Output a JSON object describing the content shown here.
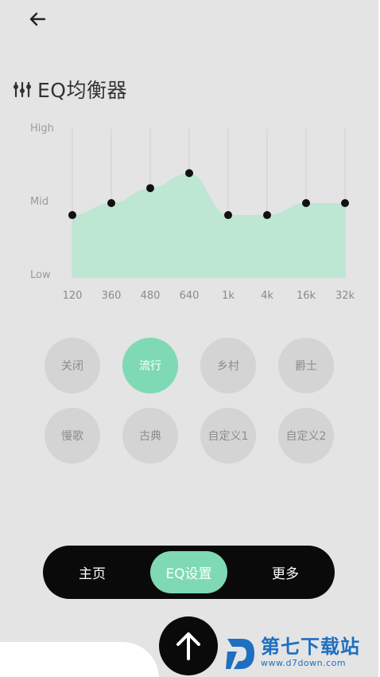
{
  "header": {
    "back_icon": "arrow-left-icon",
    "title_icon": "equalizer-sliders-icon",
    "title": "EQ均衡器"
  },
  "chart_data": {
    "type": "area",
    "categories": [
      "120",
      "360",
      "480",
      "640",
      "1k",
      "4k",
      "16k",
      "32k"
    ],
    "values": [
      0.42,
      0.5,
      0.6,
      0.7,
      0.42,
      0.42,
      0.5,
      0.5
    ],
    "y_tick_labels": [
      "High",
      "Mid",
      "Low"
    ],
    "ylim": [
      0,
      1
    ],
    "fill_color": "#bde6d3",
    "point_color": "#111111",
    "grid_color": "#cfcfcf"
  },
  "presets": {
    "items": [
      {
        "label": "关闭",
        "active": false
      },
      {
        "label": "流行",
        "active": true
      },
      {
        "label": "乡村",
        "active": false
      },
      {
        "label": "爵士",
        "active": false
      },
      {
        "label": "慢歌",
        "active": false
      },
      {
        "label": "古典",
        "active": false
      },
      {
        "label": "自定义1",
        "active": false
      },
      {
        "label": "自定义2",
        "active": false
      }
    ]
  },
  "bottom_nav": {
    "home": "主页",
    "eq": "EQ设置",
    "more": "更多"
  },
  "fab": {
    "icon": "arrow-up-icon"
  },
  "watermark": {
    "name": "第七下载站",
    "url": "www.d7down.com"
  },
  "colors": {
    "accent": "#7fd9b5",
    "background": "#e4e4e4",
    "preset_inactive": "#d4d4d4"
  }
}
